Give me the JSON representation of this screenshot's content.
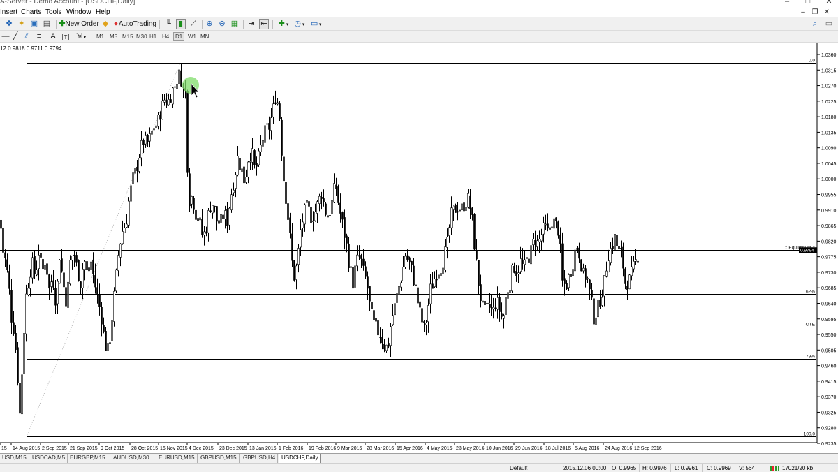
{
  "window": {
    "title": "A-Server - Demo Account - [USDCHF,Daily]",
    "controls": [
      "–",
      "□",
      "✕"
    ]
  },
  "menu": {
    "items": [
      "Insert",
      "Charts",
      "Tools",
      "Window",
      "Help"
    ]
  },
  "toolbar": {
    "new_order_label": "New Order",
    "autotrading_label": "AutoTrading",
    "timeframes": [
      "M1",
      "M5",
      "M15",
      "M30",
      "H1",
      "H4",
      "D1",
      "W1",
      "MN"
    ],
    "active_timeframe": "D1"
  },
  "chart": {
    "info_text": "12 0.9818 0.9711 0.9794",
    "current_price": "0.9794",
    "fib_labels": {
      "zero": "0.0",
      "equilibrium": ":: Equilibrium ::",
      "fib62": "62%",
      "ote": "OTE",
      "fib79": "79%",
      "hundred": "100.0"
    },
    "colors": {
      "bull": "#ffffff",
      "bear": "#000000",
      "line": "#000000",
      "grid": "#000000",
      "price_tag": "#000000",
      "cursor_highlight": "#7fdc6a"
    }
  },
  "chart_data": {
    "type": "candlestick",
    "symbol": "USDCHF",
    "timeframe": "Daily",
    "y_ticks": [
      "1.0360",
      "1.0315",
      "1.0270",
      "1.0225",
      "1.0180",
      "1.0135",
      "1.0090",
      "1.0045",
      "1.0000",
      "0.9955",
      "0.9910",
      "0.9865",
      "0.9820",
      "0.9775",
      "0.9730",
      "0.9685",
      "0.9640",
      "0.9595",
      "0.9550",
      "0.9505",
      "0.9460",
      "0.9415",
      "0.9370",
      "0.9325",
      "0.9280",
      "0.9235"
    ],
    "x_ticks": [
      "15",
      "14 Aug 2015",
      "2 Sep 2015",
      "21 Sep 2015",
      "9 Oct 2015",
      "28 Oct 2015",
      "16 Nov 2015",
      "4 Dec 2015",
      "23 Dec 2015",
      "13 Jan 2016",
      "1 Feb 2016",
      "19 Feb 2016",
      "9 Mar 2016",
      "28 Mar 2016",
      "15 Apr 2016",
      "4 May 2016",
      "23 May 2016",
      "10 Jun 2016",
      "29 Jun 2016",
      "18 Jul 2016",
      "5 Aug 2016",
      "24 Aug 2016",
      "12 Sep 2016"
    ],
    "ylim": [
      0.9235,
      1.036
    ],
    "levels": [
      {
        "label": "0.0",
        "value": 1.0335
      },
      {
        "label": ":: Equilibrium ::",
        "value": 0.9795
      },
      {
        "label": "62%",
        "value": 0.9668
      },
      {
        "label": "OTE",
        "value": 0.9572
      },
      {
        "label": "79%",
        "value": 0.948
      },
      {
        "label": "100.0",
        "value": 0.9255
      }
    ],
    "close_path": [
      [
        0,
        0.988
      ],
      [
        4,
        0.979
      ],
      [
        8,
        0.976
      ],
      [
        12,
        0.97
      ],
      [
        16,
        0.96
      ],
      [
        20,
        0.956
      ],
      [
        24,
        0.946
      ],
      [
        28,
        0.932
      ],
      [
        32,
        0.948
      ],
      [
        36,
        0.965
      ],
      [
        40,
        0.97
      ],
      [
        45,
        0.976
      ],
      [
        50,
        0.972
      ],
      [
        55,
        0.979
      ],
      [
        60,
        0.973
      ],
      [
        65,
        0.977
      ],
      [
        70,
        0.968
      ],
      [
        75,
        0.972
      ],
      [
        80,
        0.964
      ],
      [
        85,
        0.978
      ],
      [
        90,
        0.97
      ],
      [
        95,
        0.964
      ],
      [
        100,
        0.976
      ],
      [
        105,
        0.979
      ],
      [
        110,
        0.974
      ],
      [
        115,
        0.97
      ],
      [
        120,
        0.977
      ],
      [
        125,
        0.972
      ],
      [
        130,
        0.976
      ],
      [
        135,
        0.97
      ],
      [
        140,
        0.965
      ],
      [
        145,
        0.96
      ],
      [
        150,
        0.952
      ],
      [
        155,
        0.95
      ],
      [
        160,
        0.96
      ],
      [
        165,
        0.97
      ],
      [
        170,
        0.98
      ],
      [
        175,
        0.985
      ],
      [
        180,
        0.987
      ],
      [
        185,
        0.995
      ],
      [
        190,
        1.0
      ],
      [
        195,
        1.003
      ],
      [
        200,
        1.008
      ],
      [
        205,
        1.011
      ],
      [
        210,
        1.01
      ],
      [
        215,
        1.012
      ],
      [
        220,
        1.015
      ],
      [
        225,
        1.016
      ],
      [
        230,
        1.02
      ],
      [
        235,
        1.023
      ],
      [
        240,
        1.022
      ],
      [
        245,
        1.025
      ],
      [
        250,
        1.027
      ],
      [
        255,
        1.03
      ],
      [
        258,
        1.03
      ],
      [
        262,
        1.026
      ],
      [
        266,
        1.025
      ],
      [
        268,
        1.004
      ],
      [
        270,
        0.994
      ],
      [
        275,
        0.995
      ],
      [
        280,
        0.99
      ],
      [
        285,
        0.988
      ],
      [
        290,
        0.983
      ],
      [
        295,
        0.986
      ],
      [
        300,
        0.992
      ],
      [
        305,
        0.993
      ],
      [
        310,
        0.988
      ],
      [
        315,
        0.987
      ],
      [
        320,
        0.99
      ],
      [
        325,
        0.988
      ],
      [
        330,
        0.995
      ],
      [
        335,
        1.0
      ],
      [
        340,
        1.006
      ],
      [
        345,
        1.003
      ],
      [
        350,
        0.999
      ],
      [
        355,
        1.006
      ],
      [
        360,
        1.008
      ],
      [
        365,
        1.002
      ],
      [
        370,
        1.006
      ],
      [
        375,
        1.011
      ],
      [
        380,
        1.014
      ],
      [
        385,
        1.015
      ],
      [
        390,
        1.019
      ],
      [
        395,
        1.025
      ],
      [
        400,
        1.018
      ],
      [
        405,
        1.002
      ],
      [
        410,
        0.993
      ],
      [
        415,
        0.983
      ],
      [
        420,
        0.971
      ],
      [
        425,
        0.975
      ],
      [
        430,
        0.985
      ],
      [
        435,
        0.99
      ],
      [
        440,
        0.992
      ],
      [
        445,
        0.989
      ],
      [
        450,
        0.99
      ],
      [
        455,
        0.993
      ],
      [
        460,
        0.996
      ],
      [
        465,
        0.991
      ],
      [
        470,
        0.989
      ],
      [
        475,
        0.993
      ],
      [
        480,
        0.999
      ],
      [
        485,
        0.992
      ],
      [
        490,
        0.987
      ],
      [
        495,
        0.982
      ],
      [
        500,
        0.975
      ],
      [
        505,
        0.97
      ],
      [
        510,
        0.976
      ],
      [
        515,
        0.978
      ],
      [
        520,
        0.973
      ],
      [
        525,
        0.97
      ],
      [
        530,
        0.962
      ],
      [
        535,
        0.958
      ],
      [
        540,
        0.956
      ],
      [
        545,
        0.955
      ],
      [
        550,
        0.952
      ],
      [
        555,
        0.951
      ],
      [
        560,
        0.959
      ],
      [
        565,
        0.963
      ],
      [
        570,
        0.968
      ],
      [
        575,
        0.972
      ],
      [
        580,
        0.978
      ],
      [
        585,
        0.976
      ],
      [
        590,
        0.973
      ],
      [
        595,
        0.968
      ],
      [
        600,
        0.962
      ],
      [
        605,
        0.958
      ],
      [
        608,
        0.956
      ],
      [
        612,
        0.962
      ],
      [
        616,
        0.968
      ],
      [
        620,
        0.97
      ],
      [
        625,
        0.973
      ],
      [
        630,
        0.974
      ],
      [
        635,
        0.977
      ],
      [
        640,
        0.981
      ],
      [
        645,
        0.989
      ],
      [
        650,
        0.991
      ],
      [
        655,
        0.992
      ],
      [
        660,
        0.991
      ],
      [
        665,
        0.993
      ],
      [
        670,
        0.994
      ],
      [
        675,
        0.99
      ],
      [
        680,
        0.979
      ],
      [
        685,
        0.97
      ],
      [
        690,
        0.963
      ],
      [
        695,
        0.961
      ],
      [
        700,
        0.964
      ],
      [
        705,
        0.961
      ],
      [
        710,
        0.965
      ],
      [
        715,
        0.962
      ],
      [
        720,
        0.959
      ],
      [
        725,
        0.967
      ],
      [
        730,
        0.97
      ],
      [
        735,
        0.975
      ],
      [
        740,
        0.973
      ],
      [
        745,
        0.976
      ],
      [
        750,
        0.974
      ],
      [
        755,
        0.977
      ],
      [
        760,
        0.979
      ],
      [
        765,
        0.983
      ],
      [
        770,
        0.981
      ],
      [
        775,
        0.984
      ],
      [
        780,
        0.986
      ],
      [
        785,
        0.984
      ],
      [
        790,
        0.988
      ],
      [
        795,
        0.987
      ],
      [
        800,
        0.985
      ],
      [
        805,
        0.97
      ],
      [
        810,
        0.969
      ],
      [
        815,
        0.972
      ],
      [
        820,
        0.976
      ],
      [
        825,
        0.981
      ],
      [
        830,
        0.978
      ],
      [
        835,
        0.972
      ],
      [
        840,
        0.972
      ],
      [
        845,
        0.966
      ],
      [
        850,
        0.96
      ],
      [
        855,
        0.962
      ],
      [
        860,
        0.966
      ],
      [
        865,
        0.97
      ],
      [
        870,
        0.978
      ],
      [
        875,
        0.98
      ],
      [
        880,
        0.983
      ],
      [
        885,
        0.979
      ],
      [
        890,
        0.978
      ],
      [
        895,
        0.97
      ],
      [
        900,
        0.97
      ],
      [
        905,
        0.973
      ],
      [
        910,
        0.976
      ],
      [
        915,
        0.9794
      ]
    ]
  },
  "tabs": [
    {
      "label": "USD,M15",
      "active": false
    },
    {
      "label": "USDCAD,M5",
      "active": false
    },
    {
      "label": "EURGBP,M15",
      "active": false
    },
    {
      "label": "AUDUSD,M30",
      "active": false
    },
    {
      "label": "EURUSD,M15",
      "active": false
    },
    {
      "label": "GBPUSD,M15",
      "active": false
    },
    {
      "label": "GBPUSD,H4",
      "active": false
    },
    {
      "label": "USDCHF,Daily",
      "active": true
    }
  ],
  "status": {
    "profile": "Default",
    "datetime": "2015.12.06 00:00",
    "open": "O: 0.9965",
    "high": "H: 0.9976",
    "low": "L: 0.9961",
    "close": "C: 0.9969",
    "volume": "V: 564",
    "traffic": "17021/20 kb"
  }
}
